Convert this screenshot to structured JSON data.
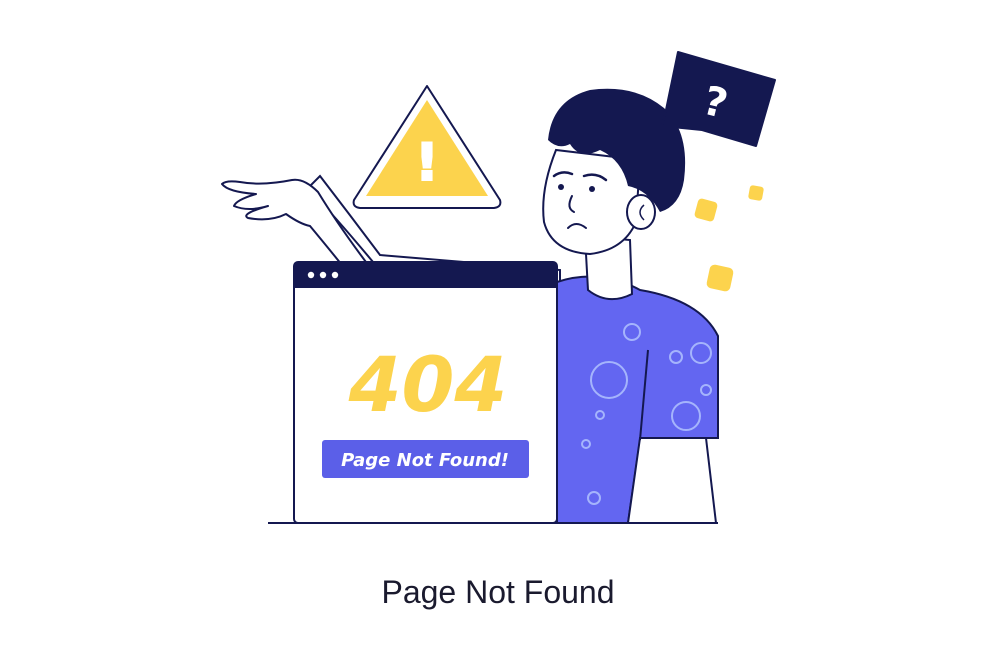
{
  "illustration": {
    "error_code": "404",
    "error_message": "Page Not Found!",
    "bubble_symbol": "?",
    "warning_symbol": "!",
    "icons": [
      "warning-triangle-icon",
      "question-bubble-icon"
    ]
  },
  "caption": "Page Not Found",
  "colors": {
    "navy": "#141850",
    "accent_yellow": "#fcd34d",
    "shirt_blue": "#6366f1",
    "badge_blue": "#5b5fe8",
    "background": "#ffffff"
  }
}
